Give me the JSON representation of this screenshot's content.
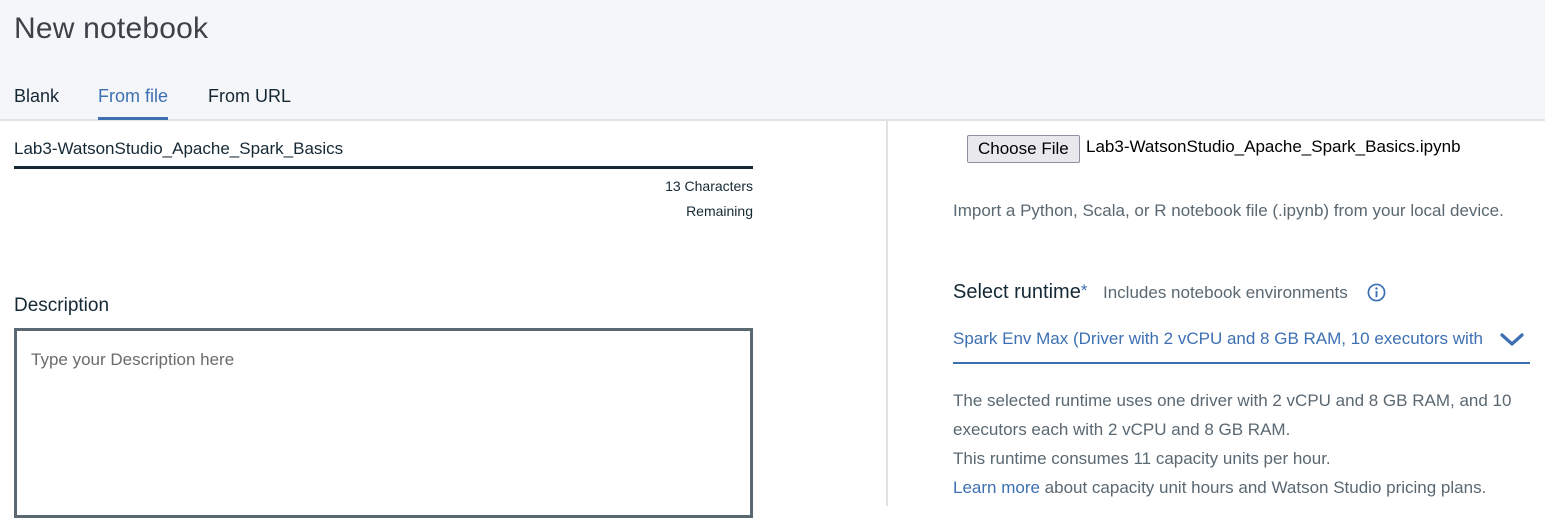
{
  "page": {
    "title": "New notebook"
  },
  "tabs": [
    {
      "label": "Blank",
      "active": false
    },
    {
      "label": "From file",
      "active": true
    },
    {
      "label": "From URL",
      "active": false
    }
  ],
  "name_field": {
    "value": "Lab3-WatsonStudio_Apache_Spark_Basics",
    "counter_line1": "13 Characters",
    "counter_line2": "Remaining"
  },
  "description": {
    "label": "Description",
    "placeholder": "Type your Description here"
  },
  "file_upload": {
    "button_label": "Choose File",
    "file_name": "Lab3-WatsonStudio_Apache_Spark_Basics.ipynb",
    "hint": "Import a Python, Scala, or R notebook file (.ipynb) from your local device."
  },
  "runtime": {
    "label": "Select runtime",
    "required_mark": "*",
    "sublabel": "Includes notebook environments",
    "selected_value": "Spark Env Max (Driver with 2 vCPU and 8 GB RAM, 10 executors with",
    "desc_line1": "The selected runtime uses one driver with 2 vCPU and 8 GB RAM, and 10 executors each with 2 vCPU and 8 GB RAM.",
    "desc_line2": "This runtime consumes 11 capacity units per hour.",
    "learn_more_link": "Learn more",
    "learn_more_rest": " about capacity unit hours and Watson Studio pricing plans."
  },
  "colors": {
    "accent": "#3d70b2",
    "header_bg": "#f4f6fa",
    "text_primary": "#152935",
    "text_secondary": "#5a6872"
  },
  "icons": {
    "info": "info-icon",
    "dropdown": "chevron-down-icon"
  }
}
